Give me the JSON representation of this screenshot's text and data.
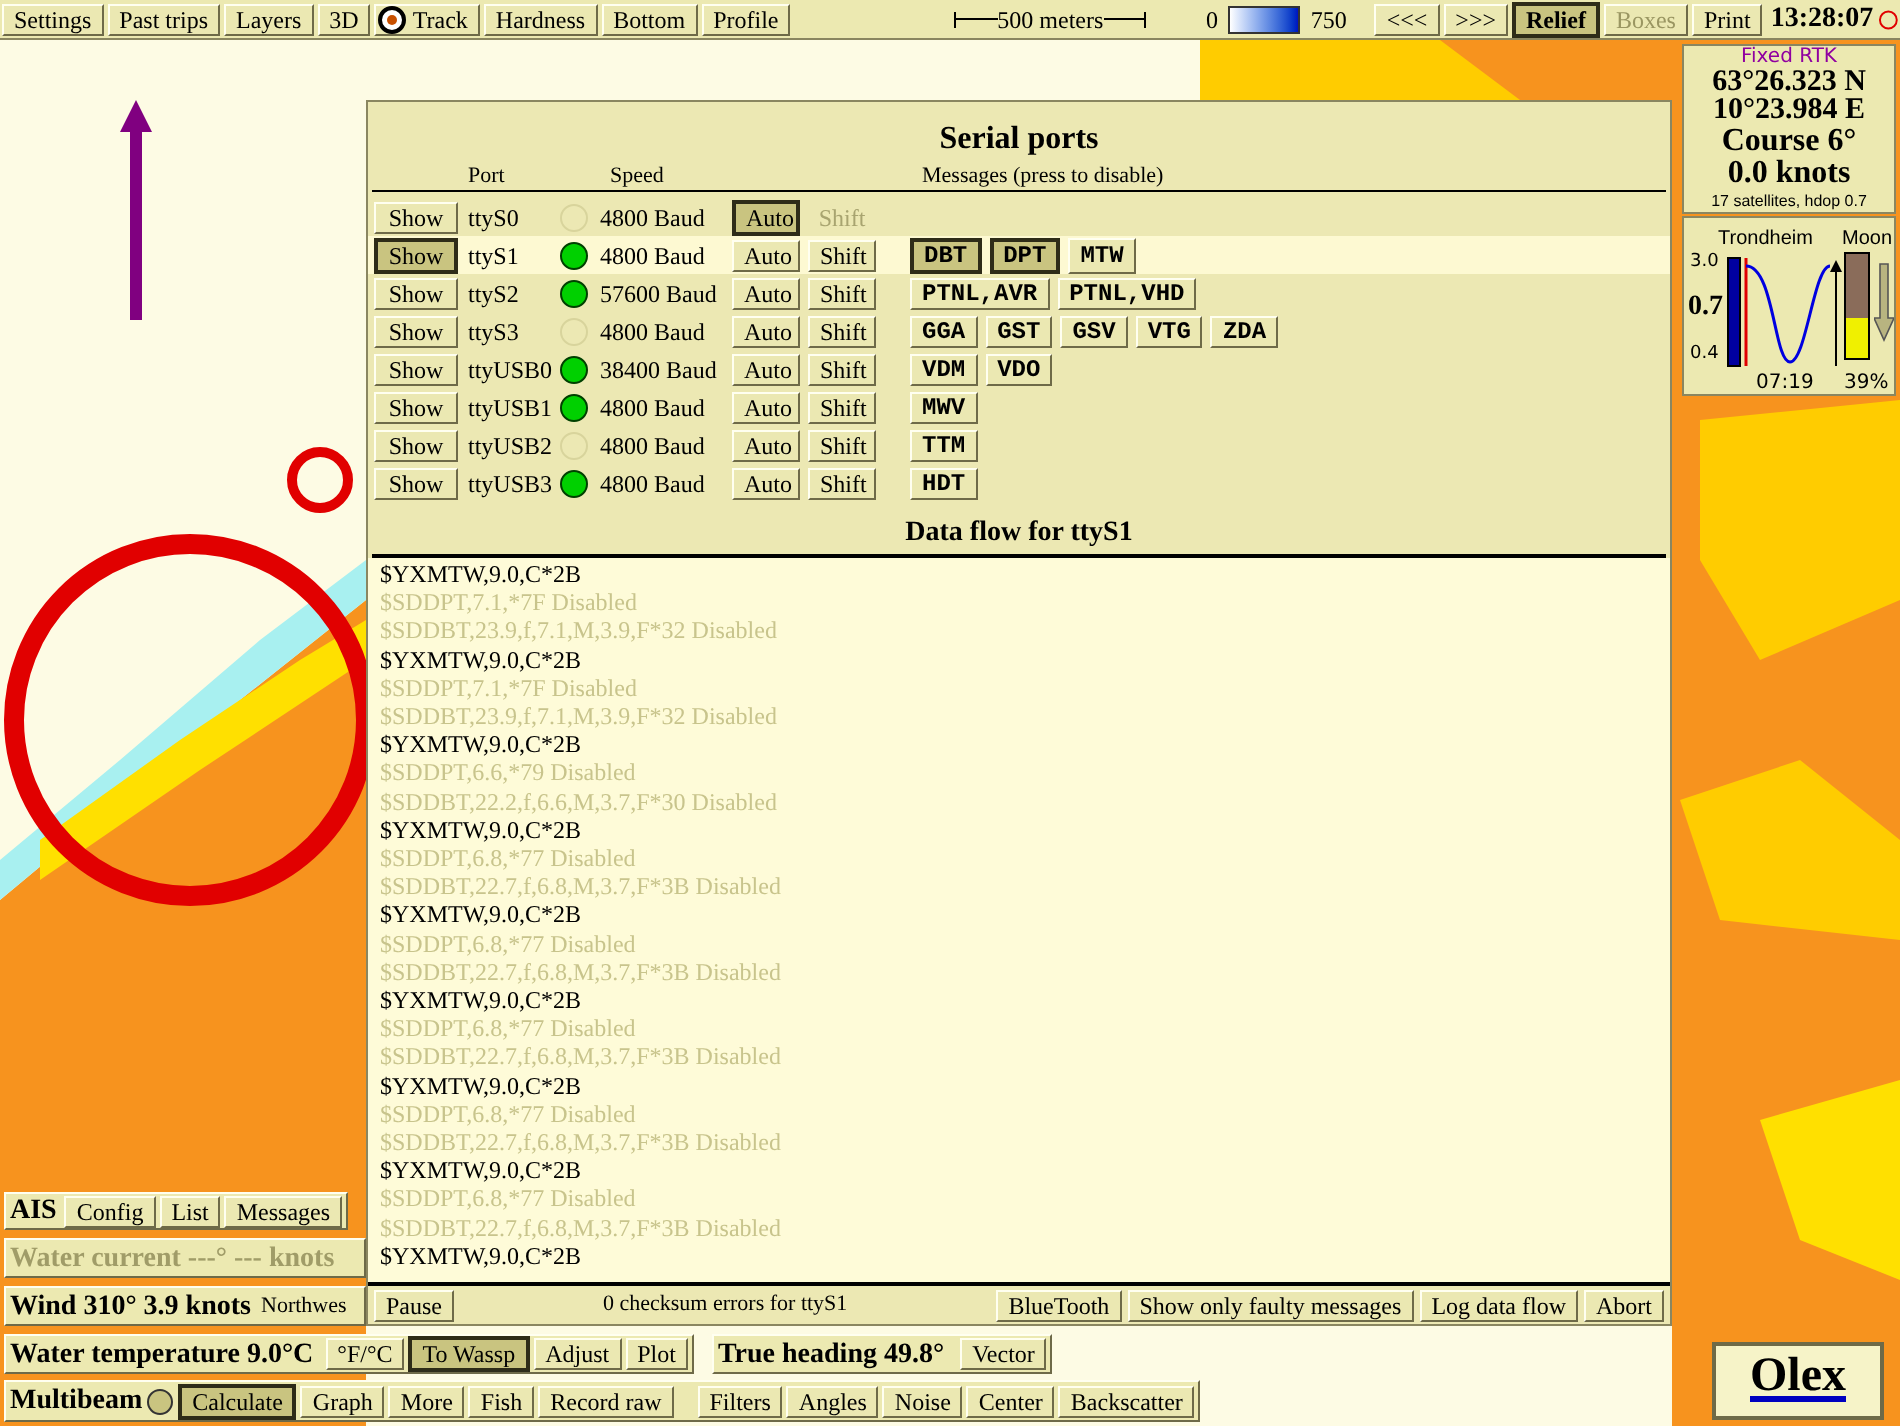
{
  "toolbar": {
    "left_buttons": [
      {
        "label": "Settings",
        "kind": "button",
        "pressed": false
      },
      {
        "label": "Past trips",
        "kind": "button",
        "pressed": false
      },
      {
        "label": "Layers",
        "kind": "button",
        "pressed": false
      },
      {
        "label": "3D",
        "kind": "button",
        "pressed": false
      },
      {
        "label": "Track",
        "kind": "track",
        "pressed": false
      },
      {
        "label": "Hardness",
        "kind": "button",
        "pressed": false
      },
      {
        "label": "Bottom",
        "kind": "button",
        "pressed": false
      },
      {
        "label": "Profile",
        "kind": "button",
        "pressed": false
      }
    ],
    "scale": "500 meters",
    "depth_min": "0",
    "depth_max": "750",
    "right_buttons": [
      {
        "label": "<<<",
        "pressed": false,
        "disabled": false
      },
      {
        "label": ">>>",
        "pressed": false,
        "disabled": false
      },
      {
        "label": "Relief",
        "pressed": true,
        "disabled": false
      },
      {
        "label": "Boxes",
        "pressed": false,
        "disabled": true
      },
      {
        "label": "Print",
        "pressed": false,
        "disabled": false
      }
    ],
    "clock": "13:28:07"
  },
  "position_panel": {
    "fix": "Fixed RTK",
    "latitude": "63°26.323 N",
    "longitude": "10°23.984 E",
    "course": "Course 6°",
    "speed": "0.0 knots",
    "satellites": "17 satellites, hdop 0.7"
  },
  "tide_panel": {
    "place": "Trondheim",
    "max": "3.0",
    "current": "0.7",
    "min": "0.4",
    "time": "07:19",
    "moon": {
      "label": "Moon",
      "level": 0.39,
      "reading": "39%"
    }
  },
  "dialog": {
    "title": "Serial ports",
    "columns": {
      "port": "Port",
      "speed": "Speed",
      "messages": "Messages (press to disable)"
    },
    "ports": [
      {
        "show": "Show",
        "selected": false,
        "name": "ttyS0",
        "active": false,
        "speed": "4800 Baud",
        "auto": {
          "label": "Auto",
          "pressed": true
        },
        "shift": {
          "label": "Shift",
          "disabled": true
        }
      },
      {
        "show": "Show",
        "selected": true,
        "name": "ttyS1",
        "active": true,
        "speed": "4800 Baud",
        "auto": {
          "label": "Auto",
          "pressed": false
        },
        "shift": {
          "label": "Shift",
          "disabled": false
        },
        "messages": [
          {
            "label": "DBT",
            "disabled": true
          },
          {
            "label": "DPT",
            "disabled": true
          },
          {
            "label": "MTW",
            "disabled": false
          }
        ]
      },
      {
        "show": "Show",
        "selected": false,
        "name": "ttyS2",
        "active": true,
        "speed": "57600 Baud",
        "auto": {
          "label": "Auto",
          "pressed": false
        },
        "shift": {
          "label": "Shift",
          "disabled": false
        },
        "messages": [
          {
            "label": "PTNL,AVR",
            "disabled": false
          },
          {
            "label": "PTNL,VHD",
            "disabled": false
          }
        ]
      },
      {
        "show": "Show",
        "selected": false,
        "name": "ttyS3",
        "active": false,
        "speed": "4800 Baud",
        "auto": {
          "label": "Auto",
          "pressed": false
        },
        "shift": {
          "label": "Shift",
          "disabled": false
        },
        "messages": [
          {
            "label": "GGA",
            "disabled": false
          },
          {
            "label": "GST",
            "disabled": false
          },
          {
            "label": "GSV",
            "disabled": false
          },
          {
            "label": "VTG",
            "disabled": false
          },
          {
            "label": "ZDA",
            "disabled": false
          }
        ]
      },
      {
        "show": "Show",
        "selected": false,
        "name": "ttyUSB0",
        "active": true,
        "speed": "38400 Baud",
        "auto": {
          "label": "Auto",
          "pressed": false
        },
        "shift": {
          "label": "Shift",
          "disabled": false
        },
        "messages": [
          {
            "label": "VDM",
            "disabled": false
          },
          {
            "label": "VDO",
            "disabled": false
          }
        ]
      },
      {
        "show": "Show",
        "selected": false,
        "name": "ttyUSB1",
        "active": true,
        "speed": "4800 Baud",
        "auto": {
          "label": "Auto",
          "pressed": false
        },
        "shift": {
          "label": "Shift",
          "disabled": false
        },
        "messages": [
          {
            "label": "MWV",
            "disabled": false
          }
        ]
      },
      {
        "show": "Show",
        "selected": false,
        "name": "ttyUSB2",
        "active": false,
        "speed": "4800 Baud",
        "auto": {
          "label": "Auto",
          "pressed": false
        },
        "shift": {
          "label": "Shift",
          "disabled": false
        },
        "messages": [
          {
            "label": "TTM",
            "disabled": false
          }
        ]
      },
      {
        "show": "Show",
        "selected": false,
        "name": "ttyUSB3",
        "active": true,
        "speed": "4800 Baud",
        "auto": {
          "label": "Auto",
          "pressed": false
        },
        "shift": {
          "label": "Shift",
          "disabled": false
        },
        "messages": [
          {
            "label": "HDT",
            "disabled": false
          }
        ]
      }
    ],
    "data_flow": {
      "title": "Data flow for ttyS1",
      "lines": [
        {
          "text": "$YXMTW,9.0,C*2B",
          "disabled": false
        },
        {
          "text": "$SDDPT,7.1,*7F Disabled",
          "disabled": true
        },
        {
          "text": "$SDDBT,23.9,f,7.1,M,3.9,F*32 Disabled",
          "disabled": true
        },
        {
          "text": "$YXMTW,9.0,C*2B",
          "disabled": false
        },
        {
          "text": "$SDDPT,7.1,*7F Disabled",
          "disabled": true
        },
        {
          "text": "$SDDBT,23.9,f,7.1,M,3.9,F*32 Disabled",
          "disabled": true
        },
        {
          "text": "$YXMTW,9.0,C*2B",
          "disabled": false
        },
        {
          "text": "$SDDPT,6.6,*79 Disabled",
          "disabled": true
        },
        {
          "text": "$SDDBT,22.2,f,6.6,M,3.7,F*30 Disabled",
          "disabled": true
        },
        {
          "text": "$YXMTW,9.0,C*2B",
          "disabled": false
        },
        {
          "text": "$SDDPT,6.8,*77 Disabled",
          "disabled": true
        },
        {
          "text": "$SDDBT,22.7,f,6.8,M,3.7,F*3B Disabled",
          "disabled": true
        },
        {
          "text": "$YXMTW,9.0,C*2B",
          "disabled": false
        },
        {
          "text": "$SDDPT,6.8,*77 Disabled",
          "disabled": true
        },
        {
          "text": "$SDDBT,22.7,f,6.8,M,3.7,F*3B Disabled",
          "disabled": true
        },
        {
          "text": "$YXMTW,9.0,C*2B",
          "disabled": false
        },
        {
          "text": "$SDDPT,6.8,*77 Disabled",
          "disabled": true
        },
        {
          "text": "$SDDBT,22.7,f,6.8,M,3.7,F*3B Disabled",
          "disabled": true
        },
        {
          "text": "$YXMTW,9.0,C*2B",
          "disabled": false
        },
        {
          "text": "$SDDPT,6.8,*77 Disabled",
          "disabled": true
        },
        {
          "text": "$SDDBT,22.7,f,6.8,M,3.7,F*3B Disabled",
          "disabled": true
        },
        {
          "text": "$YXMTW,9.0,C*2B",
          "disabled": false
        },
        {
          "text": "$SDDPT,6.8,*77 Disabled",
          "disabled": true
        },
        {
          "text": "$SDDBT,22.7,f,6.8,M,3.7,F*3B Disabled",
          "disabled": true
        },
        {
          "text": "$YXMTW,9.0,C*2B",
          "disabled": false
        }
      ]
    },
    "footer": {
      "pause": "Pause",
      "status": "0 checksum errors for ttyS1",
      "buttons": [
        "BlueTooth",
        "Show only faulty messages",
        "Log data flow",
        "Abort"
      ]
    }
  },
  "ais": {
    "title": "AIS",
    "buttons": [
      "Config",
      "List",
      "Messages"
    ]
  },
  "water_current": {
    "text": "Water current ---° --- knots",
    "disabled": true
  },
  "wind": {
    "text": "Wind 310° 3.9 knots",
    "direction": "Northwes"
  },
  "water_temperature": {
    "text": "Water temperature 9.0°C",
    "buttons": [
      {
        "label": "°F/°C",
        "pressed": false
      },
      {
        "label": "To Wassp",
        "pressed": true
      },
      {
        "label": "Adjust",
        "pressed": false
      },
      {
        "label": "Plot",
        "pressed": false
      }
    ]
  },
  "heading": {
    "text": "True heading 49.8°",
    "buttons": [
      "Vector"
    ]
  },
  "multibeam": {
    "title": "Multibeam",
    "buttons": [
      {
        "label": "Calculate",
        "pressed": true
      },
      {
        "label": "Graph",
        "pressed": false
      },
      {
        "label": "More",
        "pressed": false
      },
      {
        "label": "Fish",
        "pressed": false
      },
      {
        "label": "Record raw",
        "pressed": false
      }
    ],
    "filter_buttons": [
      "Filters",
      "Angles",
      "Noise",
      "Center",
      "Backscatter"
    ]
  },
  "logo": "Olex"
}
